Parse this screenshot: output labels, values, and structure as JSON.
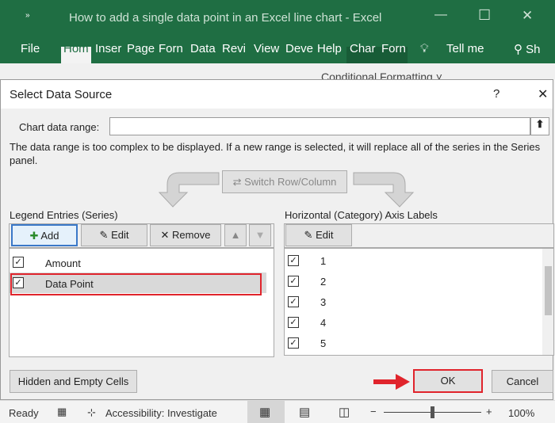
{
  "window": {
    "title": "How to add a single data point in an Excel line chart  -  Excel",
    "minimize": "—",
    "maximize": "☐",
    "close": "✕"
  },
  "ribbon_tabs": [
    "File",
    "Hom",
    "Inser",
    "Page",
    "Forn",
    "Data",
    "Revi",
    "View",
    "Deve",
    "Help",
    "Char",
    "Forn"
  ],
  "tell_me": "Tell me",
  "share": "Sh",
  "conditional_formatting": "Conditional Formatting ˅",
  "dialog": {
    "title": "Select Data Source",
    "help": "?",
    "close": "✕",
    "chart_range_label": "Chart data range:",
    "chart_range_value": "",
    "message": "The data range is too complex to be displayed. If a new range is selected, it will replace all of the series in the Series panel.",
    "switch_label": "Switch Row/Column",
    "legend_label": "Legend Entries (Series)",
    "add": "Add",
    "edit": "Edit",
    "remove": "Remove",
    "series": [
      {
        "name": "Amount",
        "checked": true
      },
      {
        "name": "Data Point",
        "checked": true
      }
    ],
    "axis_label": "Horizontal (Category) Axis Labels",
    "axis_edit": "Edit",
    "categories": [
      "1",
      "2",
      "3",
      "4",
      "5"
    ],
    "hidden_cells": "Hidden and Empty Cells",
    "ok": "OK",
    "cancel": "Cancel",
    "highlight_color": "#e0242c"
  },
  "status": {
    "ready": "Ready",
    "accessibility": "Accessibility: Investigate",
    "zoom": "100%"
  }
}
